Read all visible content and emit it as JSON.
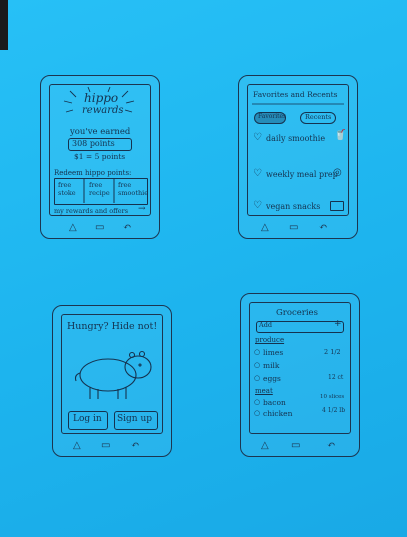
{
  "rewards": {
    "logo_line1": "hippo",
    "logo_line2": "rewards",
    "earned_label": "you've earned",
    "points_value": "308 points",
    "conversion": "$1 = 5 points",
    "redeem_heading": "Redeem hippo points:",
    "options": [
      "free stoke",
      "free recipe",
      "free smoothie"
    ],
    "link_text": "my rewards and offers"
  },
  "favorites": {
    "title": "Favorites and Recents",
    "tab_favorites": "Favorites",
    "tab_recents": "Recents",
    "items": [
      "daily smoothie",
      "weekly meal prep",
      "vegan snacks"
    ]
  },
  "login": {
    "headline": "Hungry? Hide not!",
    "login_label": "Log in",
    "signup_label": "Sign up"
  },
  "groceries": {
    "title": "Groceries",
    "add_placeholder": "Add",
    "sections": [
      {
        "name": "produce",
        "items": [
          {
            "label": "limes",
            "qty": "2 1/2"
          },
          {
            "label": "milk",
            "qty": ""
          },
          {
            "label": "eggs",
            "qty": "12 ct"
          }
        ]
      },
      {
        "name": "meat",
        "items": [
          {
            "label": "bacon",
            "qty": "10 slices"
          },
          {
            "label": "chicken",
            "qty": "4 1/2 lb"
          }
        ]
      }
    ]
  },
  "colors": {
    "paper": "#1fb8f0",
    "ink": "#15324f"
  },
  "icons": [
    "heart-icon",
    "home-icon",
    "square-icon",
    "back-arrow-icon",
    "plus-icon",
    "radio-circle-icon"
  ]
}
